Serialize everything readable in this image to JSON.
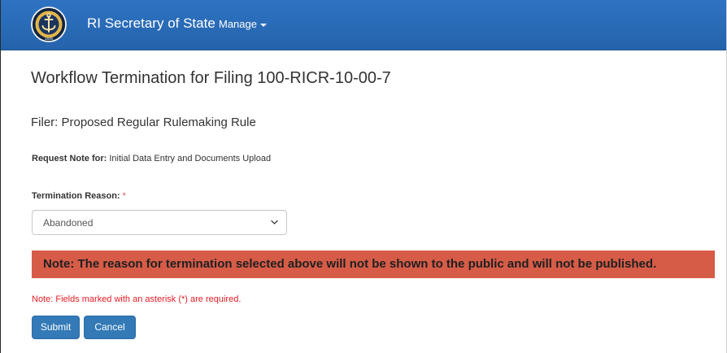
{
  "navbar": {
    "brand": "RI Secretary of State",
    "manage_label": "Manage",
    "logo_year": "1636"
  },
  "page": {
    "title": "Workflow Termination for Filing 100-RICR-10-00-7",
    "filer": "Filer: Proposed Regular Rulemaking Rule",
    "request_note_label": "Request Note for:",
    "request_note_value": "Initial Data Entry and Documents Upload"
  },
  "form": {
    "termination_label": "Termination Reason:",
    "required_marker": "*",
    "termination_value": "Abandoned"
  },
  "warning": "Note: The reason for termination selected above will not be shown to the public and will not be published.",
  "required_note": "Note: Fields marked with an asterisk (*) are required.",
  "buttons": {
    "submit": "Submit",
    "cancel": "Cancel"
  },
  "colors": {
    "navbar": "#2d73c2",
    "warning_background": "#d65c48",
    "required_text": "#e51c23",
    "button": "#337ab7"
  }
}
